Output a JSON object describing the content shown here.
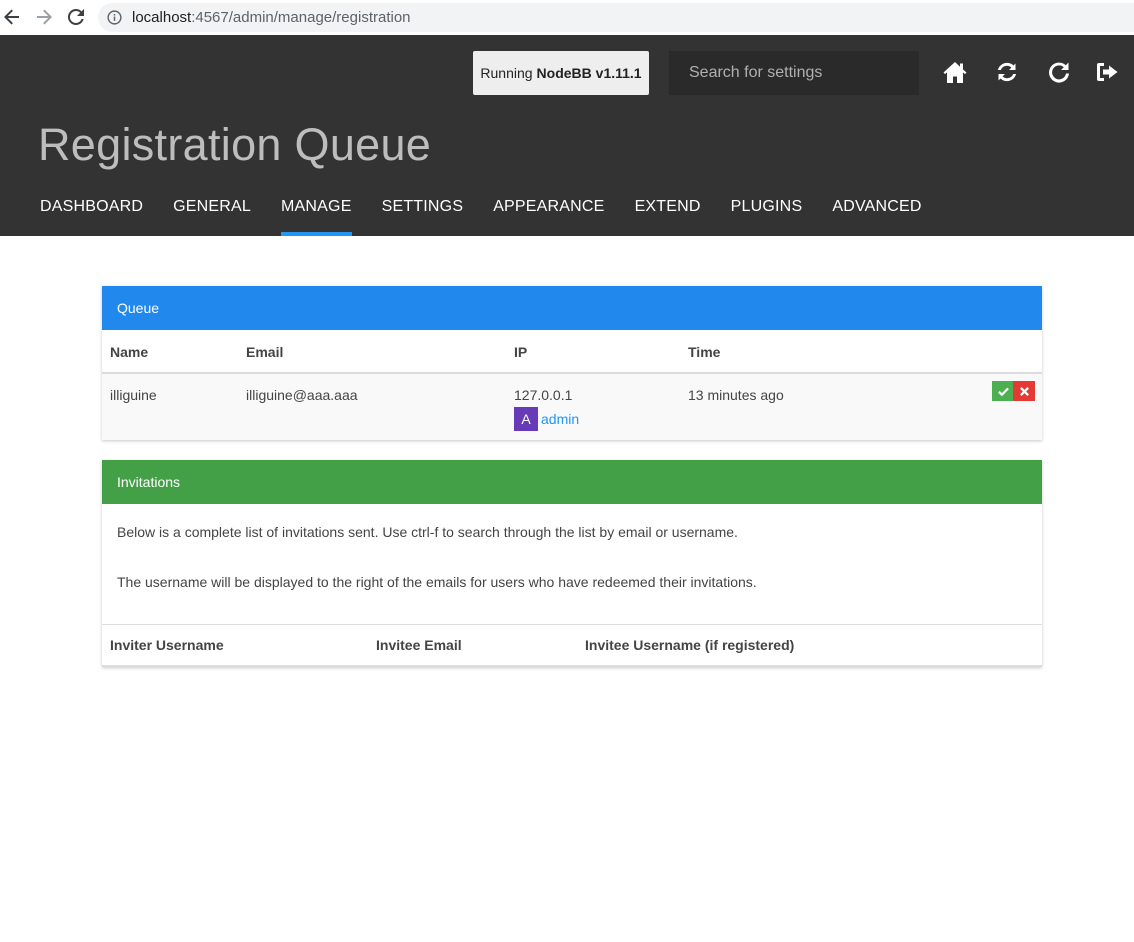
{
  "browser": {
    "url_host": "localhost",
    "url_path": ":4567/admin/manage/registration"
  },
  "header": {
    "version_prefix": "Running",
    "version_name": "NodeBB v1.11.1",
    "search_placeholder": "Search for settings",
    "page_title": "Registration Queue",
    "tabs": [
      {
        "label": "DASHBOARD",
        "active": false
      },
      {
        "label": "GENERAL",
        "active": false
      },
      {
        "label": "MANAGE",
        "active": true
      },
      {
        "label": "SETTINGS",
        "active": false
      },
      {
        "label": "APPEARANCE",
        "active": false
      },
      {
        "label": "EXTEND",
        "active": false
      },
      {
        "label": "PLUGINS",
        "active": false
      },
      {
        "label": "ADVANCED",
        "active": false
      }
    ],
    "icons": [
      "home-icon",
      "refresh-icon",
      "restart-icon",
      "logout-icon"
    ]
  },
  "queue": {
    "title": "Queue",
    "columns": [
      "Name",
      "Email",
      "IP",
      "Time"
    ],
    "rows": [
      {
        "name": "illiguine",
        "email": "illiguine@aaa.aaa",
        "ip": "127.0.0.1",
        "ip_user_avatar": "A",
        "ip_user_name": "admin",
        "time": "13 minutes ago"
      }
    ]
  },
  "invitations": {
    "title": "Invitations",
    "text1": "Below is a complete list of invitations sent. Use ctrl-f to search through the list by email or username.",
    "text2": "The username will be displayed to the right of the emails for users who have redeemed their invitations.",
    "columns": [
      "Inviter Username",
      "Invitee Email",
      "Invitee Username (if registered)"
    ]
  },
  "colors": {
    "header_bg": "#333333",
    "queue_head": "#2188ee",
    "invite_head": "#43a047",
    "accent": "#2196f3",
    "avatar": "#673ab7",
    "accept": "#4caf50",
    "reject": "#e53935"
  }
}
